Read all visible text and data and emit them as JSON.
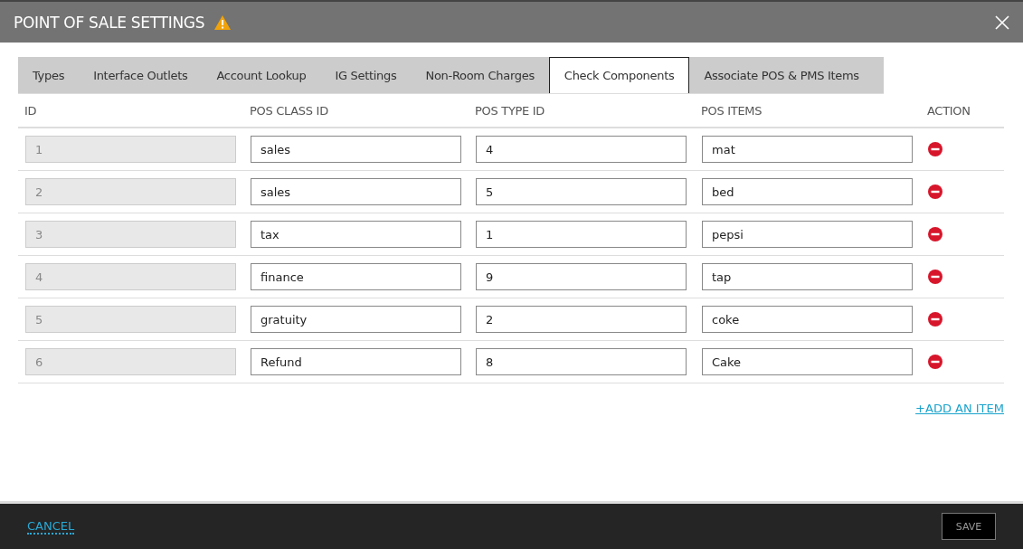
{
  "window": {
    "title": "POINT OF SALE SETTINGS",
    "warning": true
  },
  "tabs": [
    {
      "label": "Types",
      "selected": false
    },
    {
      "label": "Interface Outlets",
      "selected": false
    },
    {
      "label": "Account Lookup",
      "selected": false
    },
    {
      "label": "IG Settings",
      "selected": false
    },
    {
      "label": "Non-Room Charges",
      "selected": false
    },
    {
      "label": "Check Components",
      "selected": true
    },
    {
      "label": "Associate POS & PMS Items",
      "selected": false
    }
  ],
  "table": {
    "columns": [
      "ID",
      "POS CLASS ID",
      "POS TYPE ID",
      "POS ITEMS",
      "ACTION"
    ],
    "rows": [
      {
        "id": "1",
        "class_id": "sales",
        "type_id": "4",
        "items": "mat"
      },
      {
        "id": "2",
        "class_id": "sales",
        "type_id": "5",
        "items": "bed"
      },
      {
        "id": "3",
        "class_id": "tax",
        "type_id": "1",
        "items": "pepsi"
      },
      {
        "id": "4",
        "class_id": "finance",
        "type_id": "9",
        "items": "tap"
      },
      {
        "id": "5",
        "class_id": "gratuity",
        "type_id": "2",
        "items": "coke"
      },
      {
        "id": "6",
        "class_id": "Refund",
        "type_id": "8",
        "items": "Cake"
      }
    ]
  },
  "add_link": "+ADD AN ITEM",
  "footer": {
    "cancel": "CANCEL",
    "save": {
      "label": "SAVE",
      "disabled": true
    }
  }
}
